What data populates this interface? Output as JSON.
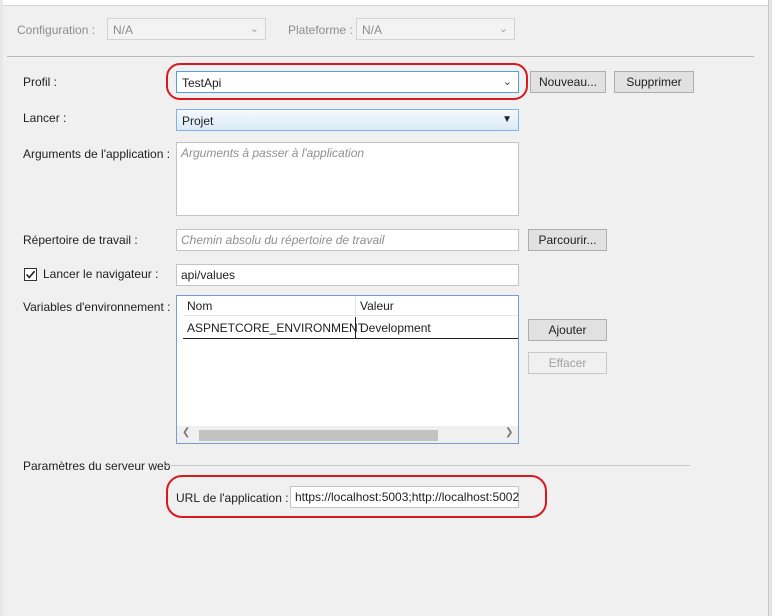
{
  "header": {
    "configuration_label": "Configuration :",
    "configuration_value": "N/A",
    "platform_label": "Plateforme :",
    "platform_value": "N/A"
  },
  "profile": {
    "label": "Profil :",
    "value": "TestApi",
    "new_button": "Nouveau...",
    "delete_button": "Supprimer"
  },
  "launch": {
    "label": "Lancer :",
    "value": "Projet"
  },
  "arguments": {
    "label": "Arguments de l'application :",
    "placeholder": "Arguments à passer à l'application"
  },
  "working_dir": {
    "label": "Répertoire de travail :",
    "placeholder": "Chemin absolu du répertoire de travail",
    "browse_button": "Parcourir..."
  },
  "browser": {
    "label": "Lancer le navigateur :",
    "checked": true,
    "value": "api/values"
  },
  "env_vars": {
    "label": "Variables d'environnement :",
    "columns": [
      "Nom",
      "Valeur"
    ],
    "rows": [
      {
        "name": "ASPNETCORE_ENVIRONMENT",
        "value": "Development"
      }
    ],
    "add_button": "Ajouter",
    "clear_button": "Effacer"
  },
  "web_server": {
    "section_label": "Paramètres du serveur web",
    "app_url_label": "URL de l'application :",
    "app_url_value": "https://localhost:5003;http://localhost:5002"
  },
  "colors": {
    "highlight_ring": "#d8191f",
    "focus_border": "#7a9cd3"
  }
}
